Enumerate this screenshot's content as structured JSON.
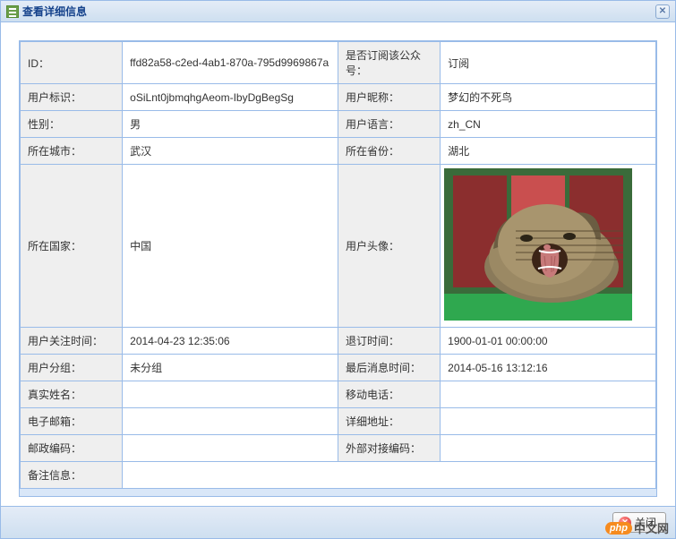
{
  "window": {
    "title": "查看详细信息"
  },
  "fields": {
    "id": {
      "label": "ID：",
      "value": "ffd82a58-c2ed-4ab1-870a-795d9969867a"
    },
    "subscribed": {
      "label": "是否订阅该公众号：",
      "value": "订阅"
    },
    "openid": {
      "label": "用户标识：",
      "value": "oSiLnt0jbmqhgAeom-IbyDgBegSg"
    },
    "nickname": {
      "label": "用户昵称：",
      "value": "梦幻的不死鸟"
    },
    "gender": {
      "label": "性别：",
      "value": "男"
    },
    "language": {
      "label": "用户语言：",
      "value": "zh_CN"
    },
    "city": {
      "label": "所在城市：",
      "value": "武汉"
    },
    "province": {
      "label": "所在省份：",
      "value": "湖北"
    },
    "country": {
      "label": "所在国家：",
      "value": "中国"
    },
    "avatar": {
      "label": "用户头像："
    },
    "subscribe_time": {
      "label": "用户关注时间：",
      "value": "2014-04-23 12:35:06"
    },
    "unsubscribe_time": {
      "label": "退订时间：",
      "value": "1900-01-01 00:00:00"
    },
    "group": {
      "label": "用户分组：",
      "value": "未分组"
    },
    "last_msg_time": {
      "label": "最后消息时间：",
      "value": "2014-05-16 13:12:16"
    },
    "real_name": {
      "label": "真实姓名：",
      "value": ""
    },
    "mobile": {
      "label": "移动电话：",
      "value": ""
    },
    "email": {
      "label": "电子邮箱：",
      "value": ""
    },
    "address": {
      "label": "详细地址：",
      "value": ""
    },
    "postcode": {
      "label": "邮政编码：",
      "value": ""
    },
    "external_code": {
      "label": "外部对接编码：",
      "value": ""
    },
    "remark": {
      "label": "备注信息：",
      "value": ""
    }
  },
  "buttons": {
    "close_footer": "关闭"
  },
  "watermark": {
    "badge": "php",
    "text": "中文网"
  }
}
